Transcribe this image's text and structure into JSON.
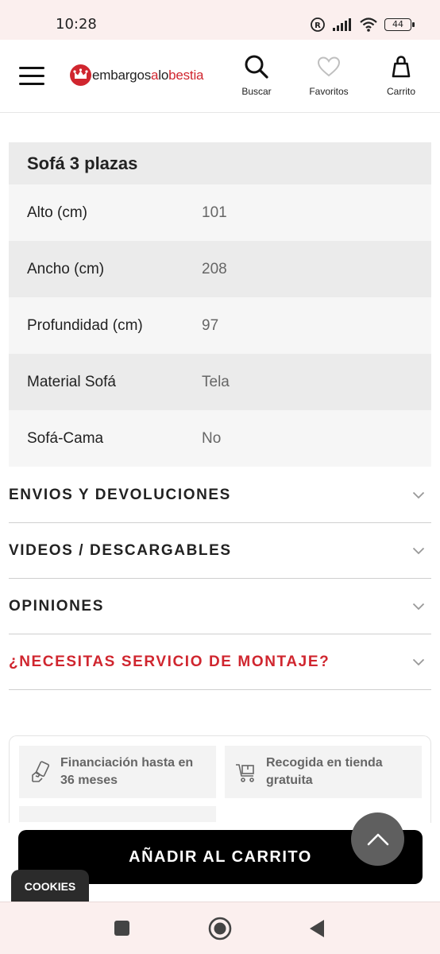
{
  "status_bar": {
    "time": "10:28",
    "battery": "44"
  },
  "header": {
    "logo_dark_1": "embargos",
    "logo_red_1": "a",
    "logo_dark_2": "lo",
    "logo_red_2": "bestia",
    "search_label": "Buscar",
    "favorites_label": "Favoritos",
    "cart_label": "Carrito"
  },
  "specs": {
    "title": "Sofá 3 plazas",
    "rows": [
      {
        "key": "Alto (cm)",
        "value": "101"
      },
      {
        "key": "Ancho (cm)",
        "value": "208"
      },
      {
        "key": "Profundidad (cm)",
        "value": "97"
      },
      {
        "key": "Material Sofá",
        "value": "Tela"
      },
      {
        "key": "Sofá-Cama",
        "value": "No"
      }
    ]
  },
  "accordion": [
    {
      "label": "ENVIOS Y DEVOLUCIONES"
    },
    {
      "label": "VIDEOS / DESCARGABLES"
    },
    {
      "label": "OPINIONES"
    },
    {
      "label": "¿NECESITAS SERVICIO DE MONTAJE?"
    }
  ],
  "benefits": [
    {
      "line1": "Financiación hasta en",
      "line2": "36 meses",
      "icon": "hand-money-icon"
    },
    {
      "line1": "Recogida en tienda",
      "line2": "gratuita",
      "icon": "cart-pickup-icon"
    }
  ],
  "actions": {
    "add_to_cart": "AÑADIR AL CARRITO",
    "cookies": "COOKIES"
  },
  "colors": {
    "brand_red": "#d0262f",
    "system_bar": "#fbefee"
  }
}
